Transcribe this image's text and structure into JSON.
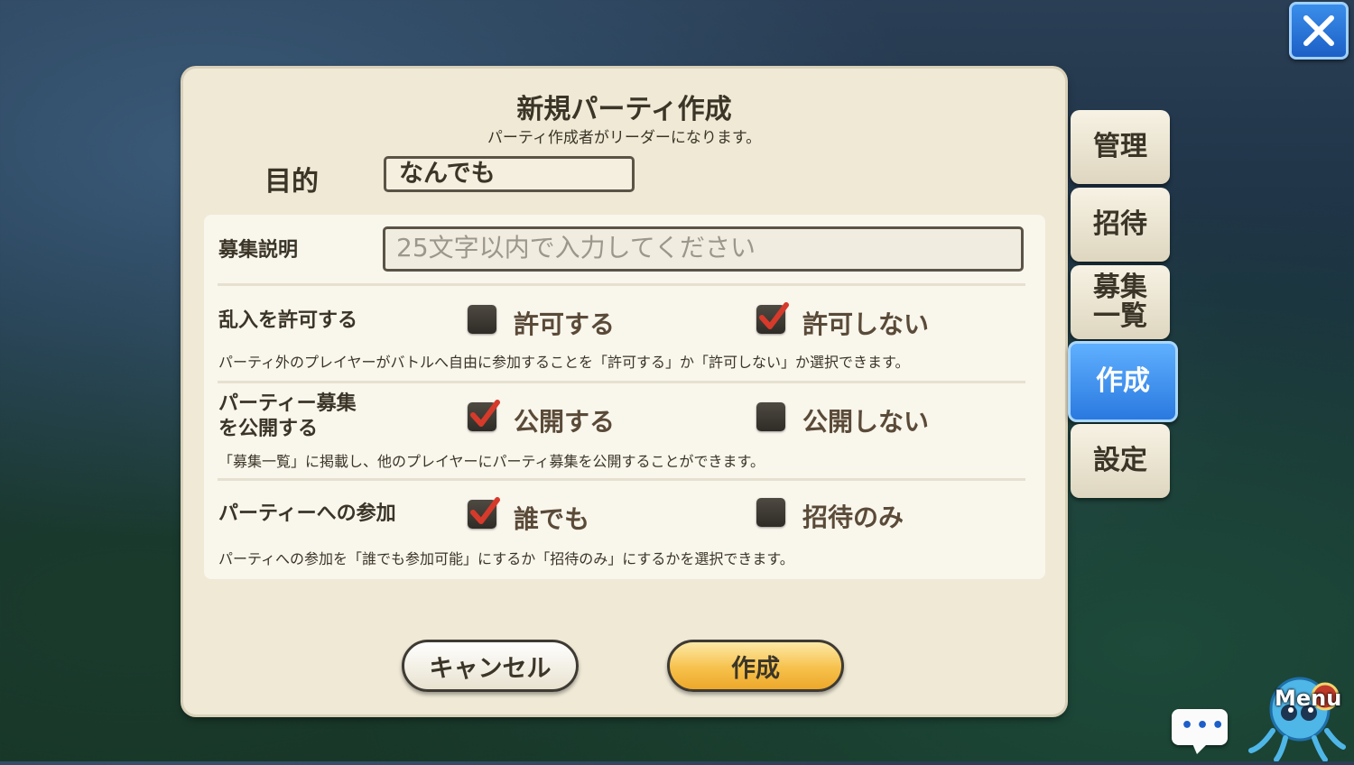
{
  "dialog": {
    "title": "新規パーティ作成",
    "subtitle": "パーティ作成者がリーダーになります。",
    "purpose_label": "目的",
    "purpose_value": "なんでも",
    "description_label": "募集説明",
    "description_placeholder": "25文字以内で入力してください",
    "intrusion": {
      "label": "乱入を許可する",
      "option_allow": "許可する",
      "option_deny": "許可しない",
      "selected": "許可しない",
      "help": "パーティ外のプレイヤーがバトルへ自由に参加することを「許可する」か「許可しない」か選択できます。"
    },
    "publish": {
      "label_line1": "パーティー募集",
      "label_line2": "を公開する",
      "option_public": "公開する",
      "option_private": "公開しない",
      "selected": "公開する",
      "help": "「募集一覧」に掲載し、他のプレイヤーにパーティ募集を公開することができます。"
    },
    "join": {
      "label": "パーティーへの参加",
      "option_anyone": "誰でも",
      "option_invite": "招待のみ",
      "selected": "誰でも",
      "help": "パーティへの参加を「誰でも参加可能」にするか「招待のみ」にするかを選択できます。"
    },
    "cancel_label": "キャンセル",
    "create_label": "作成"
  },
  "side_tabs": [
    {
      "label": "管理"
    },
    {
      "label": "招待"
    },
    {
      "label_line1": "募集",
      "label_line2": "一覧"
    },
    {
      "label": "作成",
      "active": true
    },
    {
      "label": "設定"
    }
  ],
  "menu_label": "Menu",
  "colors": {
    "panel": "#efe9d6",
    "active_tab": "#2a79e0",
    "create_button": "#f6c14c",
    "check_mark": "#d63a2a"
  }
}
